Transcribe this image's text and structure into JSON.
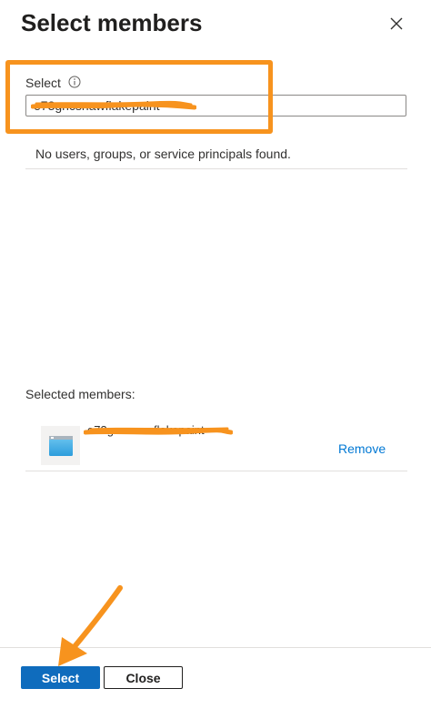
{
  "panel": {
    "title": "Select members"
  },
  "search": {
    "label": "Select",
    "value": "e73gncsnawflakepaint",
    "no_results": "No users, groups, or service principals found."
  },
  "selected": {
    "label": "Selected members:",
    "members": [
      {
        "name": "e73gncsnawflakepaint",
        "remove_label": "Remove"
      }
    ]
  },
  "footer": {
    "select_label": "Select",
    "close_label": "Close"
  },
  "colors": {
    "accent": "#0f6cbd",
    "link": "#0078d4",
    "annotation": "#f7931e",
    "divider": "#e1dfdd"
  },
  "icons": {
    "close": "close-icon",
    "info": "info-icon",
    "app": "app-window-icon"
  }
}
